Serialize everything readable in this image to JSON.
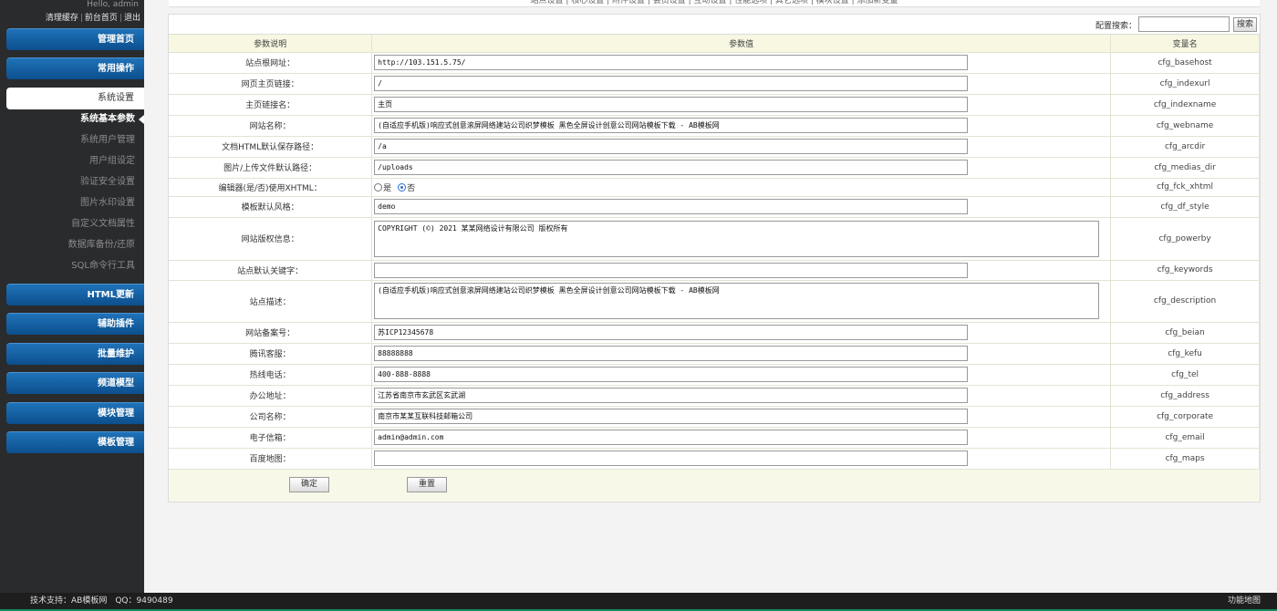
{
  "header": {
    "greeting": "Hello, admin",
    "links": [
      "清理缓存",
      "前台首页",
      "退出"
    ]
  },
  "topnav": {
    "text": "站点设置 | 核心设置 | 附件设置 | 会员设置 | 互动设置 | 性能选项 | 其它选项 | 模块设置 | 添加新变量"
  },
  "sidebar": {
    "menus": [
      {
        "label": "管理首页"
      },
      {
        "label": "常用操作"
      },
      {
        "label": "系统设置"
      },
      {
        "label": "HTML更新"
      },
      {
        "label": "辅助插件"
      },
      {
        "label": "批量维护"
      },
      {
        "label": "频道模型"
      },
      {
        "label": "模块管理"
      },
      {
        "label": "模板管理"
      }
    ],
    "sub_items": [
      {
        "label": "系统基本参数"
      },
      {
        "label": "系统用户管理"
      },
      {
        "label": "用户组设定"
      },
      {
        "label": "验证安全设置"
      },
      {
        "label": "图片水印设置"
      },
      {
        "label": "自定义文档属性"
      },
      {
        "label": "数据库备份/还原"
      },
      {
        "label": "SQL命令行工具"
      }
    ]
  },
  "search": {
    "label": "配置搜索：",
    "value": "",
    "button": "搜索"
  },
  "table": {
    "headers": [
      "参数说明",
      "参数值",
      "变量名"
    ],
    "rows": [
      {
        "label": "站点根网址：",
        "value": "http://103.151.5.75/",
        "var": "cfg_basehost"
      },
      {
        "label": "网页主页链接：",
        "value": "/",
        "var": "cfg_indexurl"
      },
      {
        "label": "主页链接名：",
        "value": "主页",
        "var": "cfg_indexname"
      },
      {
        "label": "网站名称：",
        "value": "(自适应手机版)响应式创意滚屏网络建站公司织梦模板 黑色全屏设计创意公司网站模板下载 - AB模板网",
        "var": "cfg_webname"
      },
      {
        "label": "文档HTML默认保存路径：",
        "value": "/a",
        "var": "cfg_arcdir"
      },
      {
        "label": "图片/上传文件默认路径：",
        "value": "/uploads",
        "var": "cfg_medias_dir"
      },
      {
        "label": "编辑器(是/否)使用XHTML：",
        "radio_yes": "是",
        "radio_no": "否",
        "var": "cfg_fck_xhtml"
      },
      {
        "label": "模板默认风格：",
        "value": "demo",
        "var": "cfg_df_style"
      },
      {
        "label": "网站版权信息：",
        "value": "COPYRIGHT (©) 2021 某某网络设计有限公司 版权所有",
        "var": "cfg_powerby"
      },
      {
        "label": "站点默认关键字：",
        "value": "",
        "var": "cfg_keywords"
      },
      {
        "label": "站点描述：",
        "value": "(自适应手机版)响应式创意滚屏网络建站公司织梦模板 黑色全屏设计创意公司网站模板下载 - AB模板网",
        "var": "cfg_description"
      },
      {
        "label": "网站备案号：",
        "value": "苏ICP12345678",
        "var": "cfg_beian"
      },
      {
        "label": "腾讯客服：",
        "value": "88888888",
        "var": "cfg_kefu"
      },
      {
        "label": "热线电话：",
        "value": "400-888-8888",
        "var": "cfg_tel"
      },
      {
        "label": "办公地址：",
        "value": "江苏省南京市玄武区玄武湖",
        "var": "cfg_address"
      },
      {
        "label": "公司名称：",
        "value": "南京市某某互联科技邮箱公司",
        "var": "cfg_corporate"
      },
      {
        "label": "电子信箱：",
        "value": "admin@admin.com",
        "var": "cfg_email"
      },
      {
        "label": "百度地图：",
        "value": "",
        "var": "cfg_maps"
      }
    ]
  },
  "buttons": {
    "confirm": "确定",
    "reset": "重置"
  },
  "footer": {
    "support": "技术支持：AB模板网　QQ：9490489",
    "sitemap": "功能地图"
  },
  "colors": {
    "sidebar_bg": "#2a2b2d",
    "menu_blue": "#1f72b8",
    "panel_bg": "#f8f8e8",
    "footer_accent": "#138a5e"
  }
}
